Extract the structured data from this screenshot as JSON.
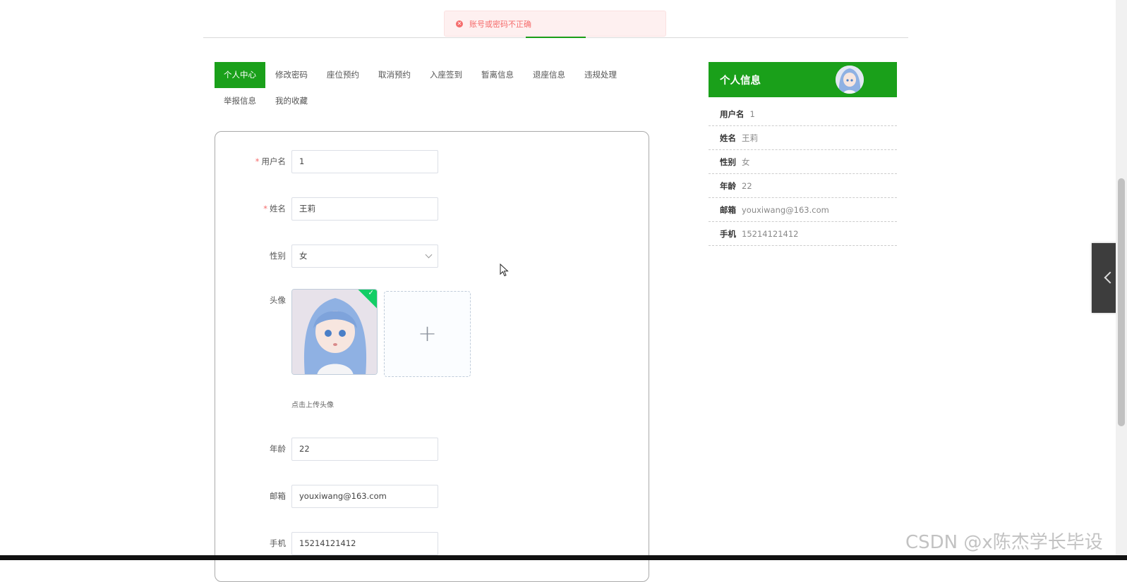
{
  "toast": {
    "message": "账号或密码不正确",
    "icon": "error-circle-icon"
  },
  "tabs": [
    {
      "label": "个人中心",
      "active": true
    },
    {
      "label": "修改密码"
    },
    {
      "label": "座位预约"
    },
    {
      "label": "取消预约"
    },
    {
      "label": "入座签到"
    },
    {
      "label": "暂离信息"
    },
    {
      "label": "退座信息"
    },
    {
      "label": "违规处理"
    },
    {
      "label": "举报信息"
    },
    {
      "label": "我的收藏"
    }
  ],
  "form": {
    "username": {
      "label": "用户名",
      "value": "1",
      "required": true
    },
    "name": {
      "label": "姓名",
      "value": "王莉",
      "required": true
    },
    "gender": {
      "label": "性别",
      "value": "女"
    },
    "avatar": {
      "label": "头像",
      "upload_hint": "点击上传头像",
      "upload_icon": "plus-icon",
      "status_icon": "check-icon"
    },
    "age": {
      "label": "年龄",
      "value": "22"
    },
    "email": {
      "label": "邮箱",
      "value": "youxiwang@163.com"
    },
    "phone": {
      "label": "手机",
      "value": "15214121412"
    }
  },
  "profile_card": {
    "title": "个人信息",
    "rows": [
      {
        "key": "用户名",
        "value": "1"
      },
      {
        "key": "姓名",
        "value": "王莉"
      },
      {
        "key": "性别",
        "value": "女"
      },
      {
        "key": "年龄",
        "value": "22"
      },
      {
        "key": "邮箱",
        "value": "youxiwang@163.com"
      },
      {
        "key": "手机",
        "value": "15214121412"
      }
    ]
  },
  "watermark": "CSDN @x陈杰学长毕设",
  "colors": {
    "primary": "#1aa01a",
    "error": "#f56c6c",
    "success": "#13ce66"
  }
}
